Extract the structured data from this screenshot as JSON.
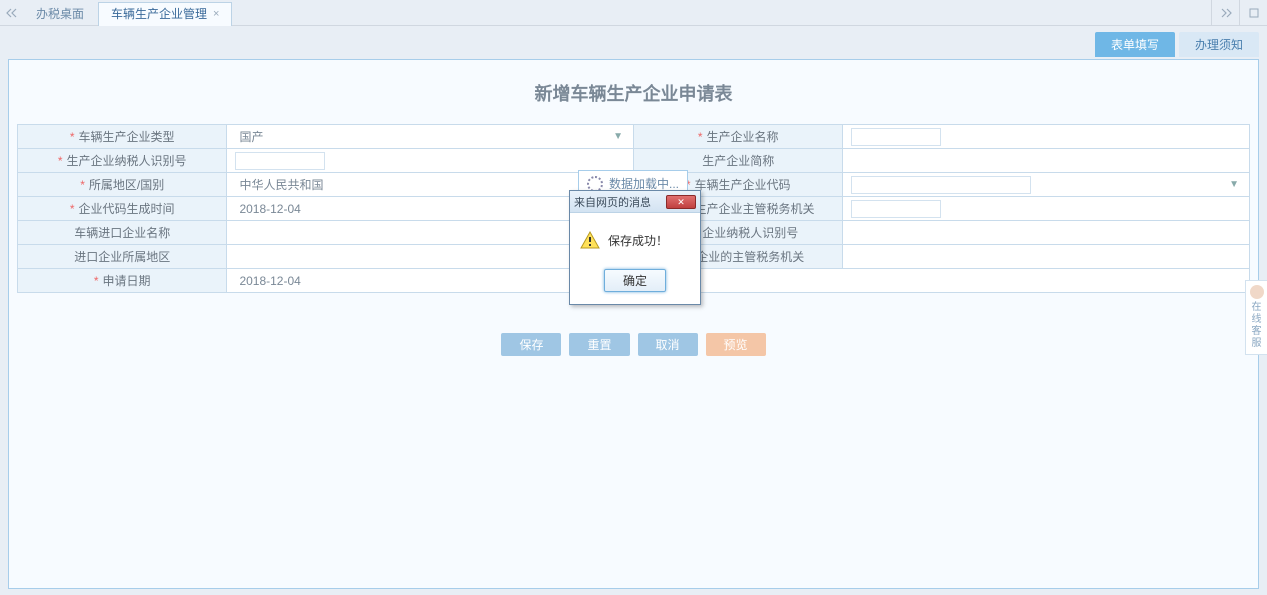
{
  "tabs": {
    "desktop": "办税桌面",
    "current": "车辆生产企业管理"
  },
  "subtabs": {
    "fill": "表单填写",
    "notice": "办理须知"
  },
  "panel": {
    "title": "新增车辆生产企业申请表"
  },
  "form": {
    "left": {
      "type_label": "车辆生产企业类型",
      "type_value": "国产",
      "taxid_label": "生产企业纳税人识别号",
      "region_label": "所属地区/国别",
      "region_value": "中华人民共和国",
      "codetime_label": "企业代码生成时间",
      "codetime_value": "2018-12-04",
      "importname_label": "车辆进口企业名称",
      "importregion_label": "进口企业所属地区",
      "applydate_label": "申请日期",
      "applydate_value": "2018-12-04"
    },
    "right": {
      "name_label": "生产企业名称",
      "short_label": "生产企业简称",
      "code_label": "车辆生产企业代码",
      "taxauth_label": "车辆生产企业主管税务机关",
      "imptaxid_label": "进口企业纳税人识别号",
      "imptaxauth_label": "进口企业的主管税务机关"
    }
  },
  "actions": {
    "save": "保存",
    "reset": "重置",
    "cancel": "取消",
    "extra": "预览"
  },
  "loading": {
    "text": "数据加载中..."
  },
  "dialog": {
    "title": "来自网页的消息",
    "message": "保存成功！",
    "ok": "确定"
  },
  "float": {
    "line1": "在线",
    "line2": "客服"
  }
}
